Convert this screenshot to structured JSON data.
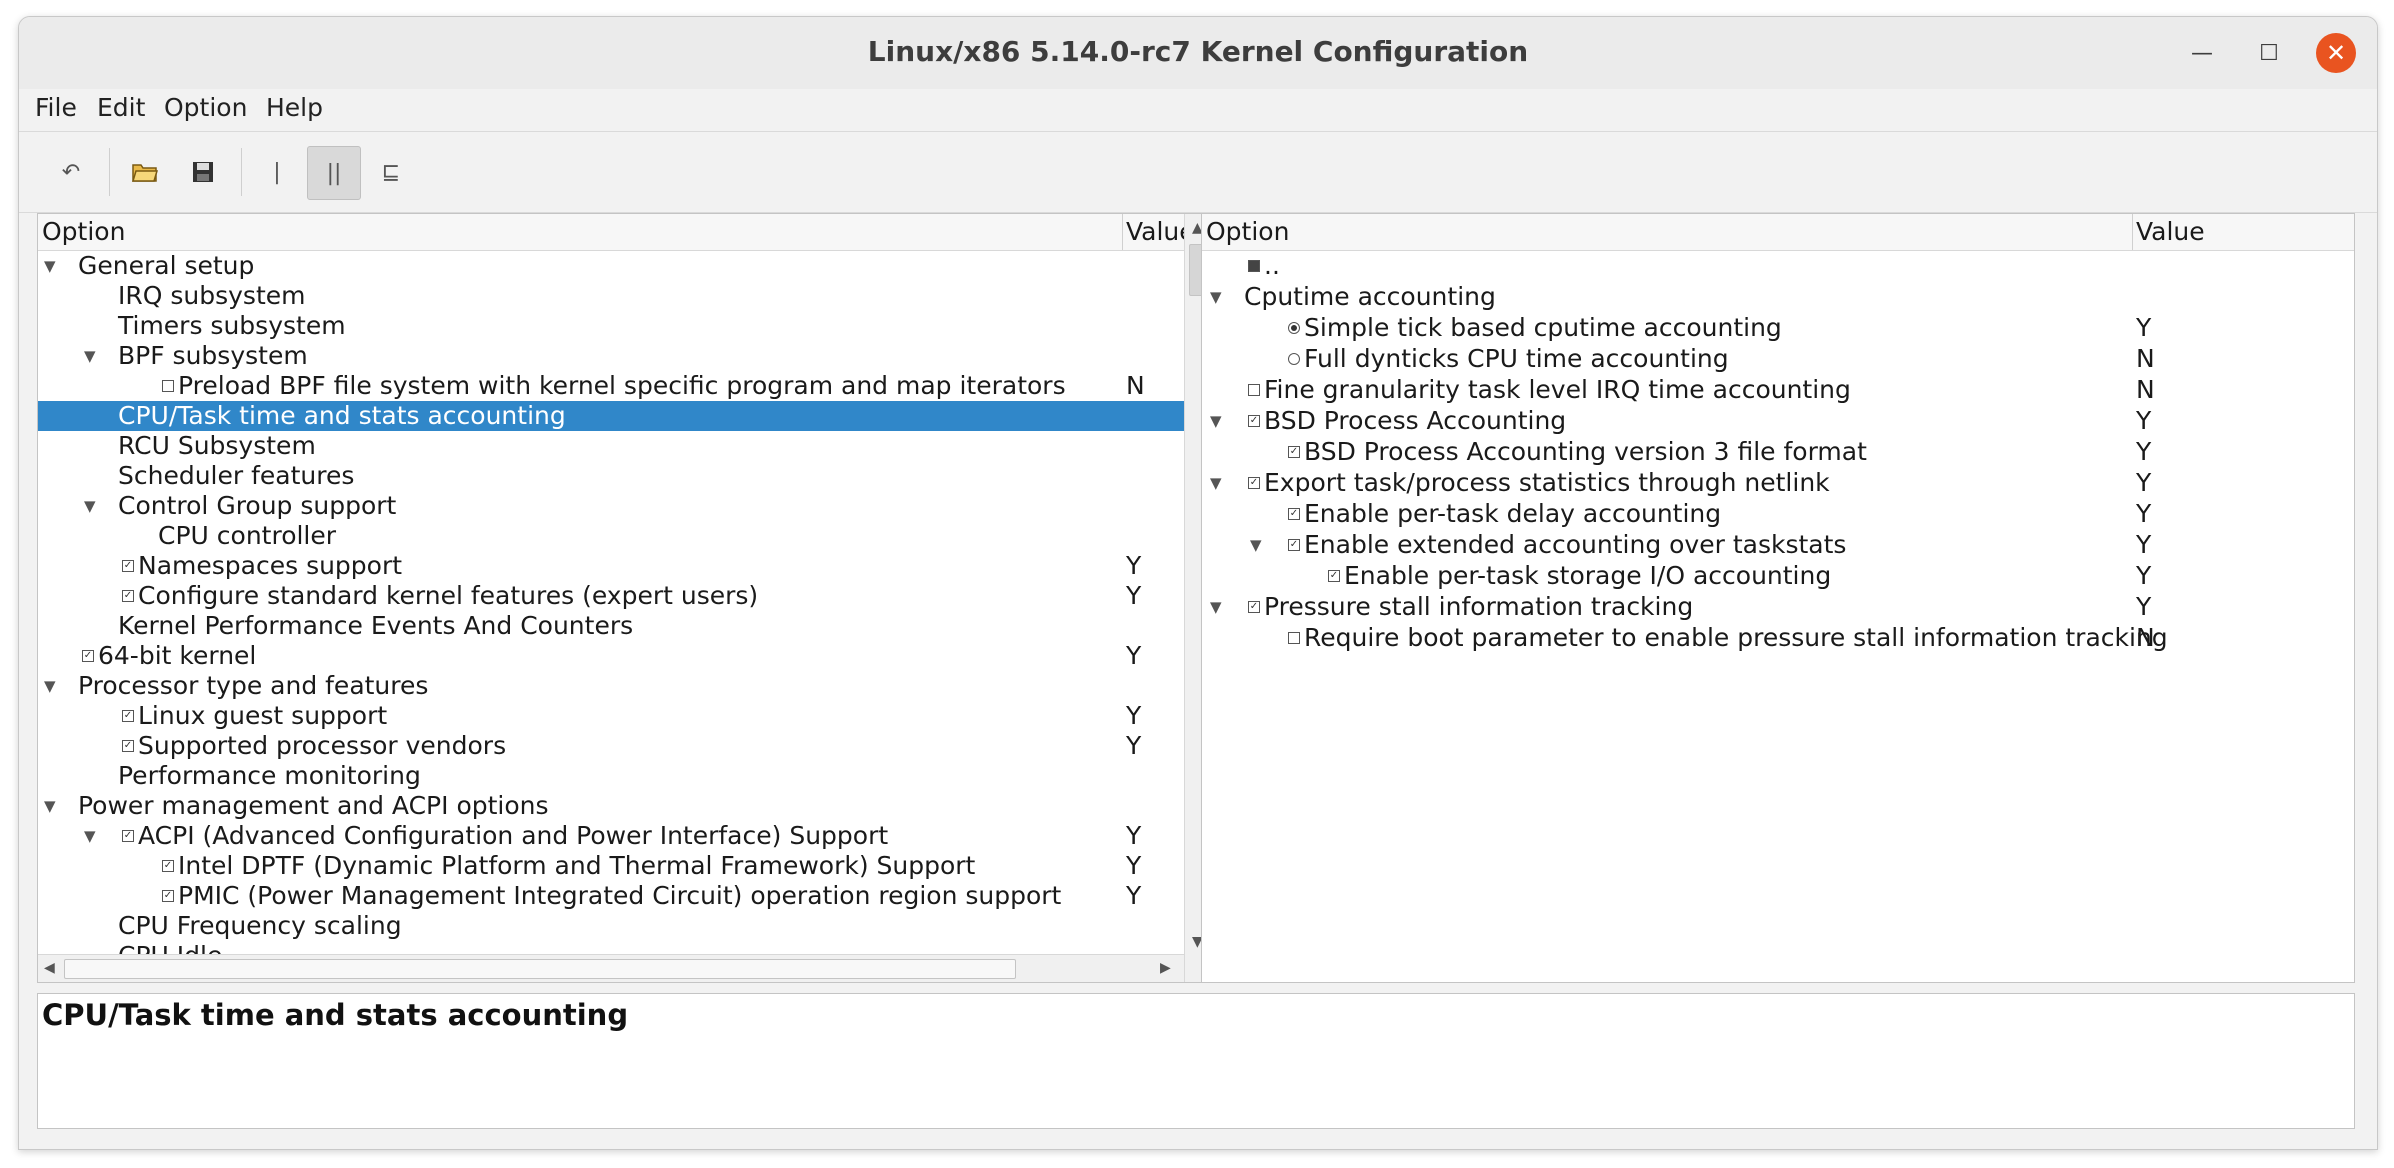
{
  "window": {
    "title": "Linux/x86 5.14.0-rc7 Kernel Configuration"
  },
  "menus": [
    "File",
    "Edit",
    "Option",
    "Help"
  ],
  "toolbar": [
    "undo-icon",
    "open-icon",
    "save-icon",
    "single-view-icon",
    "split-view-icon",
    "full-view-icon"
  ],
  "left_tree": {
    "col_option": "Option",
    "col_value": "Value",
    "rows": [
      {
        "label": "General setup",
        "value": ""
      },
      {
        "label": "IRQ subsystem",
        "value": ""
      },
      {
        "label": "Timers subsystem",
        "value": ""
      },
      {
        "label": "BPF subsystem",
        "value": ""
      },
      {
        "label": "Preload BPF file system with kernel specific program and map iterators",
        "value": "N"
      },
      {
        "label": "CPU/Task time and stats accounting",
        "value": ""
      },
      {
        "label": "RCU Subsystem",
        "value": ""
      },
      {
        "label": "Scheduler features",
        "value": ""
      },
      {
        "label": "Control Group support",
        "value": ""
      },
      {
        "label": "CPU controller",
        "value": ""
      },
      {
        "label": "Namespaces support",
        "value": "Y"
      },
      {
        "label": "Configure standard kernel features (expert users)",
        "value": "Y"
      },
      {
        "label": "Kernel Performance Events And Counters",
        "value": ""
      },
      {
        "label": "64-bit kernel",
        "value": "Y"
      },
      {
        "label": "Processor type and features",
        "value": ""
      },
      {
        "label": "Linux guest support",
        "value": "Y"
      },
      {
        "label": "Supported processor vendors",
        "value": "Y"
      },
      {
        "label": "Performance monitoring",
        "value": ""
      },
      {
        "label": "Power management and ACPI options",
        "value": ""
      },
      {
        "label": "ACPI (Advanced Configuration and Power Interface) Support",
        "value": "Y"
      },
      {
        "label": "Intel DPTF (Dynamic Platform and Thermal Framework) Support",
        "value": "Y"
      },
      {
        "label": "PMIC (Power Management Integrated Circuit) operation region support",
        "value": "Y"
      },
      {
        "label": "CPU Frequency scaling",
        "value": ""
      },
      {
        "label": "CPU Idle",
        "value": ""
      }
    ]
  },
  "right_tree": {
    "col_option": "Option",
    "col_value": "Value",
    "rows": [
      {
        "label": "..",
        "value": ""
      },
      {
        "label": "Cputime accounting",
        "value": ""
      },
      {
        "label": "Simple tick based cputime accounting",
        "value": "Y"
      },
      {
        "label": "Full dynticks CPU time accounting",
        "value": "N"
      },
      {
        "label": "Fine granularity task level IRQ time accounting",
        "value": "N"
      },
      {
        "label": "BSD Process Accounting",
        "value": "Y"
      },
      {
        "label": "BSD Process Accounting version 3 file format",
        "value": "Y"
      },
      {
        "label": "Export task/process statistics through netlink",
        "value": "Y"
      },
      {
        "label": "Enable per-task delay accounting",
        "value": "Y"
      },
      {
        "label": "Enable extended accounting over taskstats",
        "value": "Y"
      },
      {
        "label": "Enable per-task storage I/O accounting",
        "value": "Y"
      },
      {
        "label": "Pressure stall information tracking",
        "value": "Y"
      },
      {
        "label": "Require boot parameter to enable pressure stall information tracking",
        "value": "N"
      }
    ]
  },
  "info": {
    "title": "CPU/Task time and stats accounting"
  },
  "colors": {
    "selection": "#3087c9",
    "close_button": "#e95420"
  }
}
